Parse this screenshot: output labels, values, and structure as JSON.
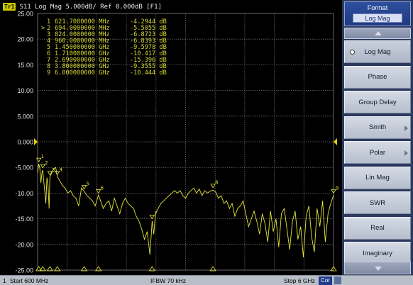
{
  "trace_header": {
    "trace_id": "Tr1",
    "title": "S11 Log Mag 5.000dB/ Ref 0.000dB [F1]"
  },
  "reference_level": "0.000",
  "markers": [
    {
      "num": "1",
      "active": false,
      "freq": "621.7080000 MHz",
      "value": "-4.2944 dB"
    },
    {
      "num": "2",
      "active": true,
      "freq": "694.0000000 MHz",
      "value": "-5.5055 dB"
    },
    {
      "num": "3",
      "active": false,
      "freq": "824.0000000 MHz",
      "value": "-6.8723 dB"
    },
    {
      "num": "4",
      "active": false,
      "freq": "960.0000000 MHz",
      "value": "-6.8393 dB"
    },
    {
      "num": "5",
      "active": false,
      "freq": "1.450000000 GHz",
      "value": "-9.5978 dB"
    },
    {
      "num": "6",
      "active": false,
      "freq": "1.710000000 GHz",
      "value": "-10.417 dB"
    },
    {
      "num": "7",
      "active": false,
      "freq": "2.690000000 GHz",
      "value": "-15.396 dB"
    },
    {
      "num": "8",
      "active": false,
      "freq": "3.800000000 GHz",
      "value": "-9.3555 dB"
    },
    {
      "num": "9",
      "active": false,
      "freq": "6.000000000 GHz",
      "value": "-10.444 dB"
    }
  ],
  "status": {
    "channel": "1",
    "start": "Start 600 MHz",
    "ifbw": "IFBW 70 kHz",
    "stop": "Stop 6 GHz",
    "correction": "Cor"
  },
  "menu": {
    "title": "Format",
    "current": "Log Mag",
    "items": [
      {
        "label": "Log Mag",
        "selected": true,
        "submenu": false
      },
      {
        "label": "Phase",
        "selected": false,
        "submenu": false
      },
      {
        "label": "Group Delay",
        "selected": false,
        "submenu": false
      },
      {
        "label": "Smith",
        "selected": false,
        "submenu": true
      },
      {
        "label": "Polar",
        "selected": false,
        "submenu": true
      },
      {
        "label": "Lin Mag",
        "selected": false,
        "submenu": false
      },
      {
        "label": "SWR",
        "selected": false,
        "submenu": false
      },
      {
        "label": "Real",
        "selected": false,
        "submenu": false
      },
      {
        "label": "Imaginary",
        "selected": false,
        "submenu": false
      }
    ]
  },
  "colors": {
    "trace": "#e6e63c",
    "grid": "#6a6a6a",
    "axis_text": "#e0e0e0",
    "reference_marker": "#e6d000"
  },
  "chart_data": {
    "type": "line",
    "title": "S11 Log Mag 5.000dB/ Ref 0.000dB [F1]",
    "xlabel": "",
    "ylabel": "",
    "x_unit": "GHz",
    "xlim": [
      0.6,
      6.0
    ],
    "ylim": [
      -25,
      25
    ],
    "y_tick_labels": [
      "25.00",
      "20.00",
      "15.00",
      "10.00",
      "5.000",
      "0.000",
      "-5.000",
      "-10.00",
      "-15.00",
      "-20.00",
      "-25.00"
    ],
    "grid": true,
    "series": [
      {
        "x": [
          0.6,
          0.615,
          0.622,
          0.64,
          0.66,
          0.68,
          0.694,
          0.71,
          0.73,
          0.75,
          0.77,
          0.79,
          0.81,
          0.824,
          0.84,
          0.86,
          0.88,
          0.9,
          0.93,
          0.96,
          1.0,
          1.05,
          1.1,
          1.15,
          1.2,
          1.25,
          1.3,
          1.35,
          1.4,
          1.45,
          1.5,
          1.55,
          1.6,
          1.65,
          1.71,
          1.75,
          1.8,
          1.85,
          1.9,
          1.95,
          2.0,
          2.05,
          2.1,
          2.15,
          2.2,
          2.25,
          2.3,
          2.35,
          2.4,
          2.45,
          2.5,
          2.55,
          2.6,
          2.65,
          2.69,
          2.72,
          2.75,
          2.8,
          2.85,
          2.9,
          2.95,
          3.0,
          3.05,
          3.1,
          3.15,
          3.2,
          3.25,
          3.3,
          3.35,
          3.4,
          3.45,
          3.5,
          3.55,
          3.6,
          3.65,
          3.7,
          3.75,
          3.8,
          3.85,
          3.9,
          3.95,
          4.0,
          4.05,
          4.1,
          4.15,
          4.2,
          4.25,
          4.3,
          4.35,
          4.4,
          4.45,
          4.5,
          4.55,
          4.6,
          4.65,
          4.7,
          4.75,
          4.8,
          4.85,
          4.9,
          4.95,
          5.0,
          5.05,
          5.1,
          5.15,
          5.2,
          5.25,
          5.3,
          5.35,
          5.4,
          5.45,
          5.5,
          5.55,
          5.6,
          5.65,
          5.7,
          5.75,
          5.8,
          5.85,
          5.9,
          5.95,
          6.0
        ],
        "values": [
          -6.0,
          -4.8,
          -4.3,
          -5.2,
          -8.0,
          -6.0,
          -5.5,
          -7.5,
          -9.5,
          -12.0,
          -7.0,
          -8.5,
          -13.0,
          -6.9,
          -6.5,
          -6.0,
          -5.5,
          -5.2,
          -5.0,
          -6.8,
          -7.5,
          -8.5,
          -9.0,
          -10.0,
          -9.5,
          -10.5,
          -11.0,
          -12.5,
          -9.0,
          -9.6,
          -10.5,
          -11.0,
          -11.5,
          -12.5,
          -10.4,
          -11.5,
          -13.0,
          -12.0,
          -11.5,
          -13.5,
          -11.0,
          -12.5,
          -14.0,
          -12.0,
          -11.0,
          -12.0,
          -12.5,
          -13.0,
          -14.5,
          -15.5,
          -17.0,
          -19.0,
          -17.5,
          -22.0,
          -15.4,
          -18.0,
          -14.0,
          -13.0,
          -12.0,
          -11.5,
          -11.0,
          -10.5,
          -10.0,
          -9.5,
          -10.0,
          -9.5,
          -10.5,
          -11.0,
          -10.0,
          -9.5,
          -9.0,
          -10.0,
          -9.2,
          -10.5,
          -9.5,
          -10.0,
          -9.6,
          -9.4,
          -9.8,
          -11.0,
          -10.5,
          -12.0,
          -11.5,
          -13.0,
          -12.0,
          -14.5,
          -13.0,
          -12.5,
          -11.5,
          -14.0,
          -16.5,
          -15.0,
          -13.5,
          -15.5,
          -18.0,
          -14.0,
          -16.0,
          -19.5,
          -13.5,
          -17.5,
          -15.0,
          -20.5,
          -14.0,
          -13.0,
          -17.0,
          -21.0,
          -15.5,
          -13.5,
          -19.0,
          -16.5,
          -22.5,
          -14.5,
          -12.5,
          -18.5,
          -21.5,
          -13.0,
          -16.5,
          -11.5,
          -19.5,
          -14.0,
          -12.0,
          -10.4
        ]
      }
    ],
    "markers": [
      {
        "n": 1,
        "x": 0.6217,
        "y": -4.2944
      },
      {
        "n": 2,
        "x": 0.694,
        "y": -5.5055
      },
      {
        "n": 3,
        "x": 0.824,
        "y": -6.8723
      },
      {
        "n": 4,
        "x": 0.96,
        "y": -6.8393
      },
      {
        "n": 5,
        "x": 1.45,
        "y": -9.5978
      },
      {
        "n": 6,
        "x": 1.71,
        "y": -10.417
      },
      {
        "n": 7,
        "x": 2.69,
        "y": -15.396
      },
      {
        "n": 8,
        "x": 3.8,
        "y": -9.3555
      },
      {
        "n": 9,
        "x": 6.0,
        "y": -10.444
      }
    ]
  }
}
